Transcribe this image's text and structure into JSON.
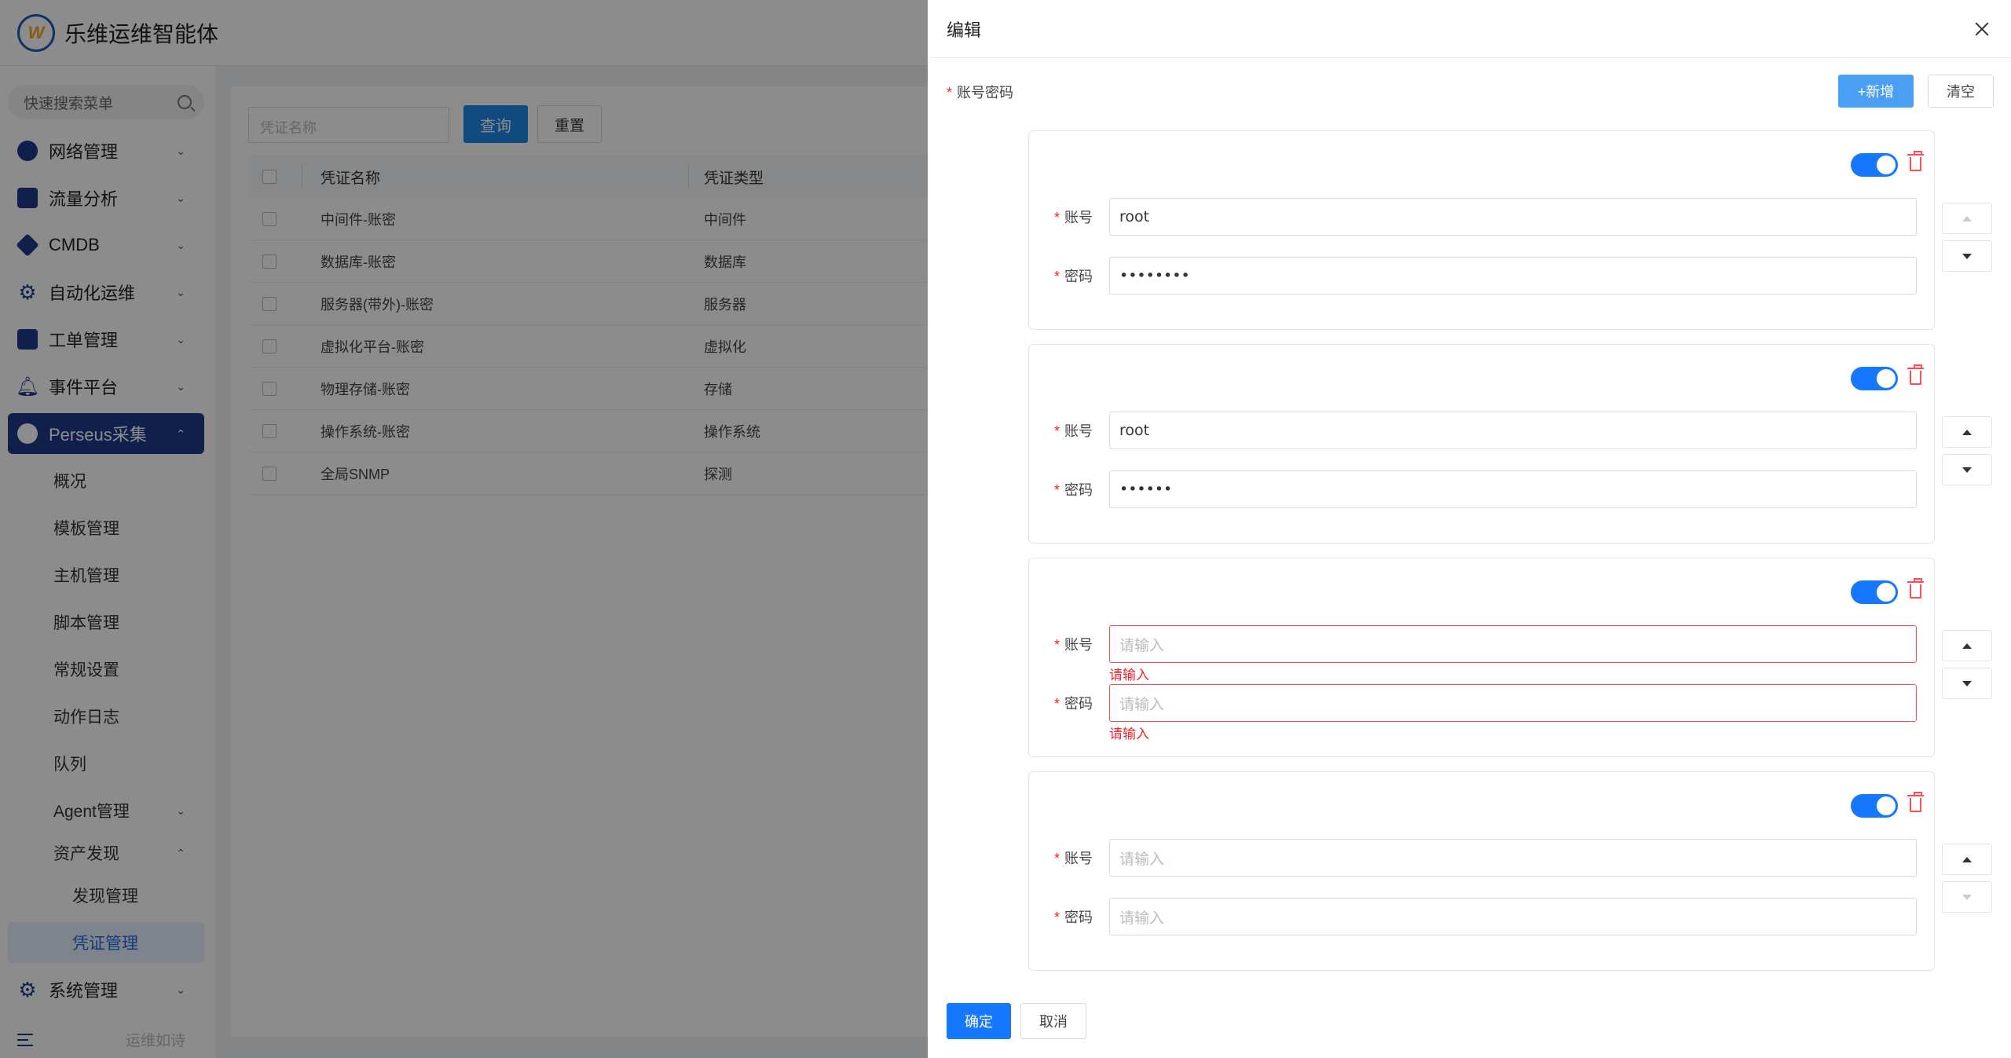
{
  "app": {
    "title": "乐维运维智能体",
    "logo_text": "W"
  },
  "sidebar": {
    "search_placeholder": "快速搜索菜单",
    "menu": [
      {
        "label": "网络管理",
        "icon": "globe-icon"
      },
      {
        "label": "流量分析",
        "icon": "chart-icon"
      },
      {
        "label": "CMDB",
        "icon": "cube-icon"
      },
      {
        "label": "自动化运维",
        "icon": "gear-icon"
      },
      {
        "label": "工单管理",
        "icon": "calendar-icon"
      },
      {
        "label": "事件平台",
        "icon": "bell-icon"
      },
      {
        "label": "Perseus采集",
        "icon": "perseus-icon"
      }
    ],
    "perseus_children": [
      "概况",
      "模板管理",
      "主机管理",
      "脚本管理",
      "常规设置",
      "动作日志",
      "队列",
      "Agent管理",
      "资产发现"
    ],
    "discovery_children": [
      "发现管理",
      "凭证管理"
    ],
    "system": "系统管理",
    "footer_text": "运维如诗"
  },
  "main": {
    "filter_placeholder": "凭证名称",
    "query_label": "查询",
    "reset_label": "重置",
    "columns": [
      "凭证名称",
      "凭证类型"
    ],
    "rows": [
      {
        "name": "中间件-账密",
        "type": "中间件"
      },
      {
        "name": "数据库-账密",
        "type": "数据库"
      },
      {
        "name": "服务器(带外)-账密",
        "type": "服务器"
      },
      {
        "name": "虚拟化平台-账密",
        "type": "虚拟化"
      },
      {
        "name": "物理存储-账密",
        "type": "存储"
      },
      {
        "name": "操作系统-账密",
        "type": "操作系统"
      },
      {
        "name": "全局SNMP",
        "type": "探测"
      }
    ]
  },
  "drawer": {
    "title": "编辑",
    "field_label": "账号密码",
    "add_label": "+新增",
    "clear_label": "清空",
    "account_label": "账号",
    "password_label": "密码",
    "placeholder": "请输入",
    "error_text": "请输入",
    "cards": [
      {
        "account": "root",
        "password": "••••••••",
        "enabled": true
      },
      {
        "account": "root",
        "password": "••••••",
        "enabled": true
      },
      {
        "account": "",
        "password": "",
        "enabled": true,
        "error": true
      },
      {
        "account": "",
        "password": "",
        "enabled": true
      }
    ],
    "ok_label": "确定",
    "cancel_label": "取消"
  },
  "colors": {
    "primary": "#1677ff",
    "sidebar_active": "#1e3a8a",
    "danger": "#ff4d4f"
  }
}
